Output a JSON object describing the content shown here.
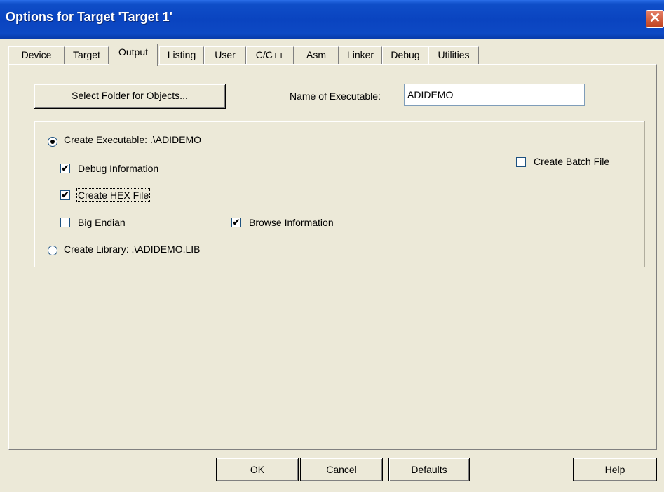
{
  "window": {
    "title": "Options for Target 'Target 1'",
    "close_glyph": "✕"
  },
  "tabs": [
    {
      "label": "Device"
    },
    {
      "label": "Target"
    },
    {
      "label": "Output"
    },
    {
      "label": "Listing"
    },
    {
      "label": "User"
    },
    {
      "label": "C/C++"
    },
    {
      "label": "Asm"
    },
    {
      "label": "Linker"
    },
    {
      "label": "Debug"
    },
    {
      "label": "Utilities"
    }
  ],
  "active_tab": "Output",
  "output": {
    "select_folder_button": "Select Folder for Objects...",
    "name_label": "Name of Executable:",
    "name_value": "ADIDEMO",
    "create_executable": {
      "label": "Create Executable:  .\\ADIDEMO",
      "selected": true
    },
    "debug_info": {
      "label": "Debug Information",
      "checked": true
    },
    "create_hex": {
      "label": "Create HEX File",
      "checked": true
    },
    "big_endian": {
      "label": "Big Endian",
      "checked": false
    },
    "browse_info": {
      "label": "Browse Information",
      "checked": true
    },
    "create_batch": {
      "label": "Create Batch File",
      "checked": false
    },
    "create_library": {
      "label": "Create Library:  .\\ADIDEMO.LIB",
      "selected": false
    },
    "check_glyph": "✔"
  },
  "buttons": {
    "ok": "OK",
    "cancel": "Cancel",
    "defaults": "Defaults",
    "help": "Help"
  },
  "colors": {
    "titlebar": "#0a44c0",
    "dialog_bg": "#ece9d8",
    "close": "#c0401c"
  }
}
